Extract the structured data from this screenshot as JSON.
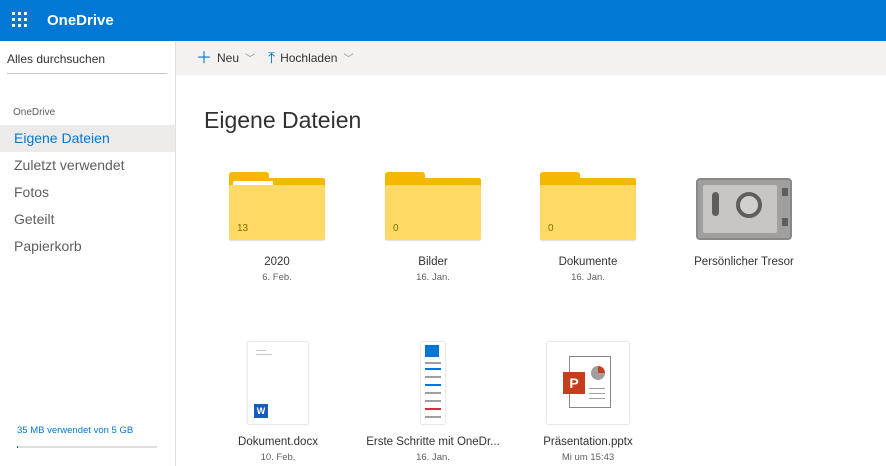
{
  "app": {
    "title": "OneDrive"
  },
  "sidebar": {
    "search_label": "Alles durchsuchen",
    "section_label": "OneDrive",
    "items": [
      {
        "label": "Eigene Dateien",
        "active": true
      },
      {
        "label": "Zuletzt verwendet"
      },
      {
        "label": "Fotos"
      },
      {
        "label": "Geteilt"
      },
      {
        "label": "Papierkorb"
      }
    ],
    "storage": {
      "label": "35 MB verwendet von 5 GB",
      "used_fraction": 0.007
    }
  },
  "commandbar": {
    "new_label": "Neu",
    "upload_label": "Hochladen"
  },
  "main": {
    "title": "Eigene Dateien"
  },
  "files": [
    {
      "name": "2020",
      "date": "6. Feb.",
      "kind": "folder",
      "count": "13"
    },
    {
      "name": "Bilder",
      "date": "16. Jan.",
      "kind": "folder",
      "count": "0"
    },
    {
      "name": "Dokumente",
      "date": "16. Jan.",
      "kind": "folder",
      "count": "0"
    },
    {
      "name": "Persönlicher Tresor",
      "date": "",
      "kind": "vault"
    },
    {
      "name": "Dokument.docx",
      "date": "10. Feb.",
      "kind": "docx"
    },
    {
      "name": "Erste Schritte mit OneDr...",
      "date": "16. Jan.",
      "kind": "pdf"
    },
    {
      "name": "Präsentation.pptx",
      "date": "Mi um 15:43",
      "kind": "pptx"
    }
  ],
  "colors": {
    "accent": "#0078d4",
    "folder": "#ffd966",
    "folder_tab": "#f5b800"
  }
}
